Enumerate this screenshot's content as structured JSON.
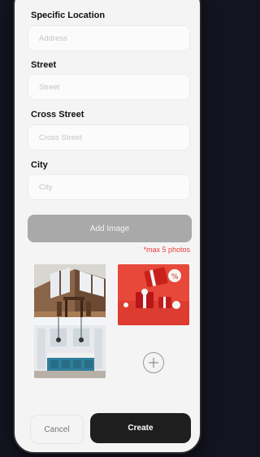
{
  "form": {
    "specific_location": {
      "label": "Specific Location",
      "placeholder": "Address",
      "value": ""
    },
    "street": {
      "label": "Street",
      "placeholder": "Street",
      "value": ""
    },
    "cross_street": {
      "label": "Cross Street",
      "placeholder": "Cross Street",
      "value": ""
    },
    "city": {
      "label": "City",
      "placeholder": "City",
      "value": ""
    }
  },
  "images": {
    "add_button_label": "Add Image",
    "limit_hint": "*max 5 photos",
    "photos": [
      "attic-room-photo",
      "red-gift-boxes-photo",
      "kitchen-photo"
    ],
    "add_more_icon": "plus-icon"
  },
  "actions": {
    "cancel_label": "Cancel",
    "create_label": "Create"
  },
  "colors": {
    "accent_dark": "#1e1e1e",
    "hint_red": "#f03a3a",
    "add_image_gray": "#a9a9a9"
  }
}
